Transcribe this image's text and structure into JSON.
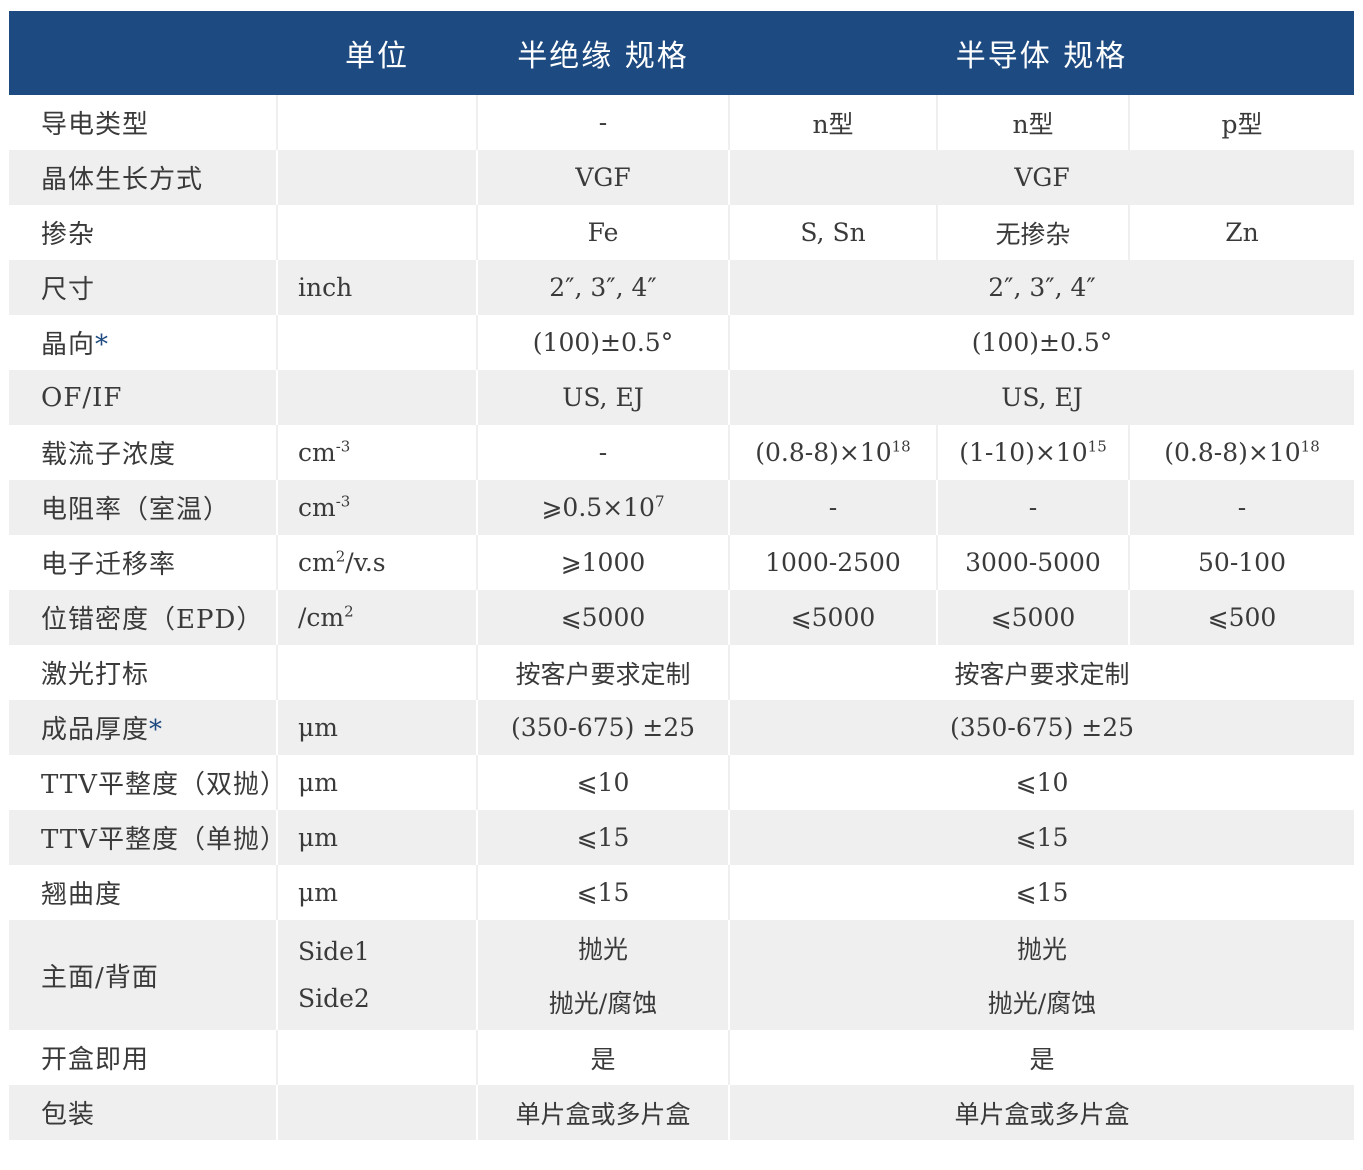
{
  "header": {
    "blank": "",
    "unit": "单位",
    "semi_ins": "半绝缘 规格",
    "semi": "半导体 规格"
  },
  "colors": {
    "header_bg": "#1d4a80",
    "stripe": "#efefef",
    "star": "#1d4a80"
  },
  "rows": {
    "r1": {
      "label": "导电类型",
      "unit": "",
      "si": "-",
      "n1": "n型",
      "n2": "n型",
      "p": "p型"
    },
    "r2": {
      "label": "晶体生长方式",
      "unit": "",
      "si": "VGF",
      "sc": "VGF"
    },
    "r3": {
      "label": "掺杂",
      "unit": "",
      "si": "Fe",
      "n1": "S, Sn",
      "n2": "无掺杂",
      "p": "Zn"
    },
    "r4": {
      "label": "尺寸",
      "unit": "inch",
      "si": "2″, 3″, 4″",
      "sc": "2″, 3″, 4″"
    },
    "r5": {
      "label": "晶向",
      "star": "*",
      "unit": "",
      "si": "(100)±0.5°",
      "sc": "(100)±0.5°"
    },
    "r6": {
      "label": "OF/IF",
      "unit": "",
      "si": "US, EJ",
      "sc": "US, EJ"
    },
    "r7": {
      "label": "载流子浓度",
      "unit_base": "cm",
      "unit_sup": "-3",
      "si": "-",
      "n1_base": "(0.8-8)×10",
      "n1_sup": "18",
      "n2_base": "(1-10)×10",
      "n2_sup": "15",
      "p_base": "(0.8-8)×10",
      "p_sup": "18"
    },
    "r8": {
      "label": "电阻率（室温）",
      "unit_base": "cm",
      "unit_sup": "-3",
      "si_base": "⩾0.5×10",
      "si_sup": "7",
      "n1": "-",
      "n2": "-",
      "p": "-"
    },
    "r9": {
      "label": "电子迁移率",
      "unit_base": "cm",
      "unit_sup": "2",
      "unit_tail": "/v.s",
      "si": "⩾1000",
      "n1": "1000-2500",
      "n2": "3000-5000",
      "p": "50-100"
    },
    "r10": {
      "label": "位错密度（EPD）",
      "unit_base": "/cm",
      "unit_sup": "2",
      "si": "⩽5000",
      "n1": "⩽5000",
      "n2": "⩽5000",
      "p": "⩽500"
    },
    "r11": {
      "label": "激光打标",
      "unit": "",
      "si": "按客户要求定制",
      "sc": "按客户要求定制"
    },
    "r12": {
      "label": "成品厚度",
      "star": "*",
      "unit": "μm",
      "si": "(350-675) ±25",
      "sc": "(350-675) ±25"
    },
    "r13": {
      "label": "TTV平整度（双抛）",
      "unit": "μm",
      "si": "⩽10",
      "sc": "⩽10"
    },
    "r14": {
      "label": "TTV平整度（单抛）",
      "unit": "μm",
      "si": "⩽15",
      "sc": "⩽15"
    },
    "r15": {
      "label": "翘曲度",
      "unit": "μm",
      "si": "⩽15",
      "sc": "⩽15"
    },
    "r16": {
      "label": "主面/背面",
      "unit1": "Side1",
      "unit2": "Side2",
      "si1": "抛光",
      "si2": "抛光/腐蚀",
      "sc1": "抛光",
      "sc2": "抛光/腐蚀"
    },
    "r17": {
      "label": "开盒即用",
      "unit": "",
      "si": "是",
      "sc": "是"
    },
    "r18": {
      "label": "包装",
      "unit": "",
      "si": "单片盒或多片盒",
      "sc": "单片盒或多片盒"
    }
  }
}
